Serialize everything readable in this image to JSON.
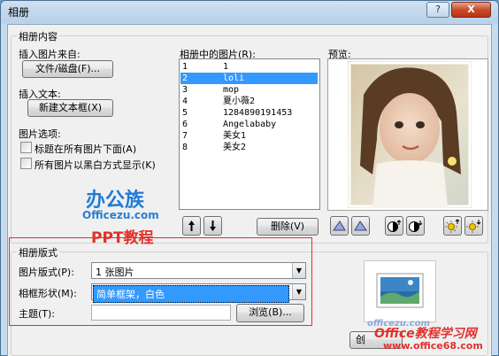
{
  "window": {
    "title": "相册",
    "help_label": "?",
    "close_label": "X"
  },
  "album_content": {
    "legend": "相册内容",
    "insert_from_label": "插入图片来自:",
    "file_button": "文件/磁盘(F)...",
    "insert_text_label": "插入文本:",
    "new_textbox_button": "新建文本框(X)",
    "options_label": "图片选项:",
    "caption_checkbox": "标题在所有图片下面(A)",
    "bw_checkbox": "所有图片以黑白方式显示(K)",
    "pictures_label": "相册中的图片(R):",
    "pictures": [
      {
        "num": "1",
        "name": "1"
      },
      {
        "num": "2",
        "name": "loli"
      },
      {
        "num": "3",
        "name": "mop"
      },
      {
        "num": "4",
        "name": "夏小薇2"
      },
      {
        "num": "5",
        "name": "1284890191453"
      },
      {
        "num": "6",
        "name": "Angelababy"
      },
      {
        "num": "7",
        "name": "美女1"
      },
      {
        "num": "8",
        "name": "美女2"
      }
    ],
    "selected_index": 1,
    "delete_button": "删除(V)",
    "preview_label": "预览:"
  },
  "album_layout": {
    "legend": "相册版式",
    "picture_layout_label": "图片版式(P):",
    "picture_layout_value": "1 张图片",
    "frame_shape_label": "相框形状(M):",
    "frame_shape_value": "简单框架，白色",
    "theme_label": "主题(T):",
    "theme_value": "",
    "browse_button": "浏览(B)...",
    "create_button": "创"
  },
  "watermarks": {
    "logo_top": "办公族",
    "logo_url": "Officezu.com",
    "logo_sub": "PPT教程",
    "site_logo": "officezu.com",
    "bottom_brand": "Office教程学习网",
    "bottom_url": "www.office68.com"
  },
  "colors": {
    "selection": "#3399ff",
    "highlight_border": "#e0312b",
    "accent_logo": "#1e7bd6",
    "watermark_red": "#e0312b"
  }
}
